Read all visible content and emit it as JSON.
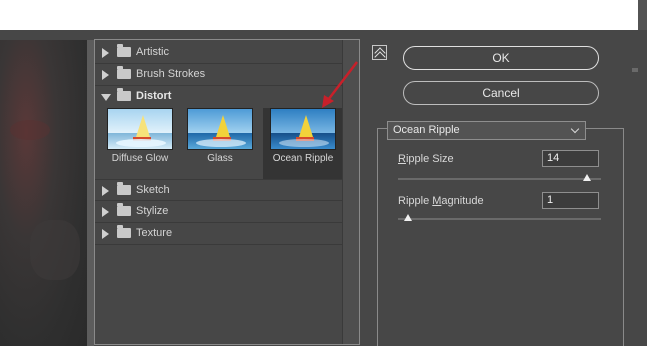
{
  "filter_gallery": {
    "categories_before": [
      {
        "label": "Artistic"
      },
      {
        "label": "Brush Strokes"
      }
    ],
    "open_category": {
      "label": "Distort",
      "thumbnails": [
        {
          "label": "Diffuse Glow"
        },
        {
          "label": "Glass"
        },
        {
          "label": "Ocean Ripple",
          "selected": true
        }
      ]
    },
    "categories_after": [
      {
        "label": "Sketch"
      },
      {
        "label": "Stylize"
      },
      {
        "label": "Texture"
      }
    ]
  },
  "buttons": {
    "ok": "OK",
    "cancel": "Cancel"
  },
  "settings": {
    "filter_select": "Ocean Ripple",
    "ripple_size": {
      "label_pre": "",
      "label_u": "R",
      "label_post": "ipple Size",
      "value": "14",
      "slider_fraction": 0.93
    },
    "ripple_magnitude": {
      "label_pre": "Ripple ",
      "label_u": "M",
      "label_post": "agnitude",
      "value": "1",
      "slider_fraction": 0.05
    }
  },
  "colors": {
    "panel_bg": "#474747",
    "annotation_arrow": "#c8202a"
  },
  "icons": [
    "folder-icon",
    "expand-arrow-icon",
    "collapse-panel-icon",
    "chevron-down-icon"
  ]
}
